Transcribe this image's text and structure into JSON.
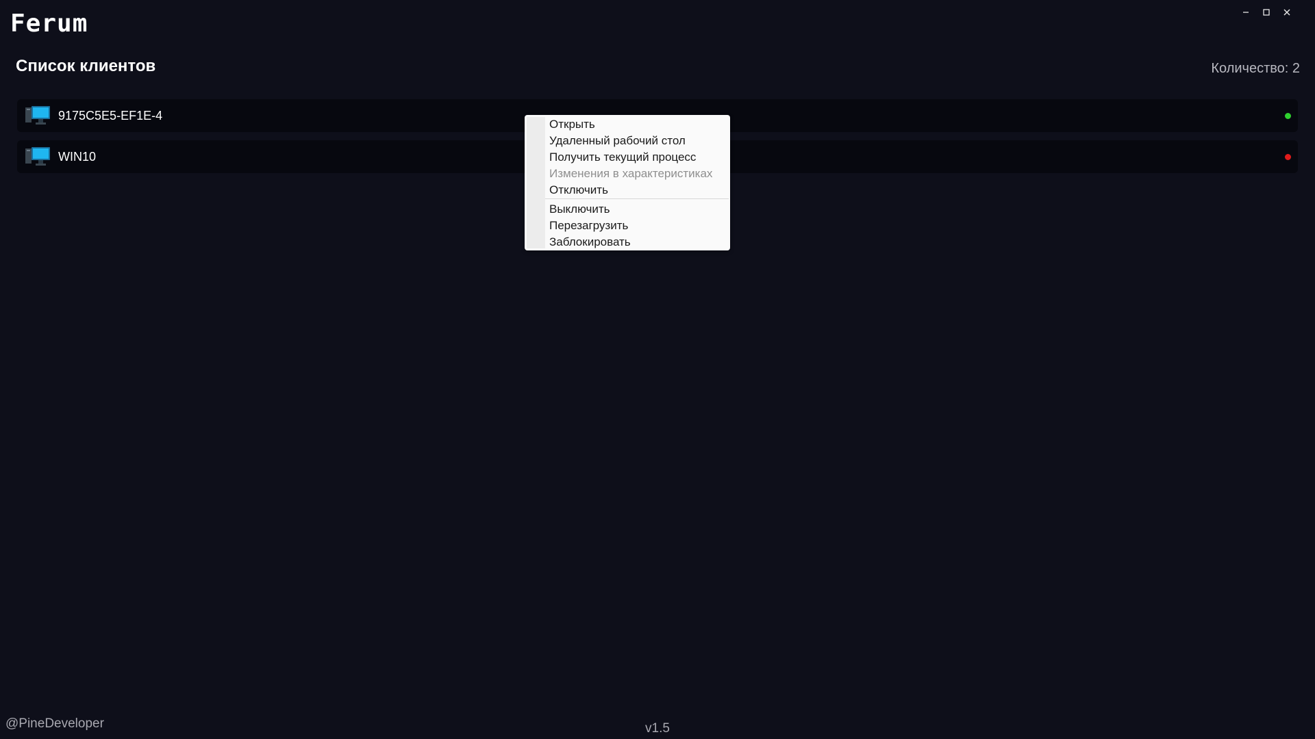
{
  "app": {
    "logo": "Ferum"
  },
  "window_controls": {
    "minimize_icon": "minimize-icon",
    "maximize_icon": "maximize-icon",
    "close_icon": "close-icon"
  },
  "header": {
    "title": "Список клиентов",
    "count_text": "Количество: 2"
  },
  "clients": [
    {
      "name": "9175C5E5-EF1E-4",
      "status": "online",
      "status_color": "#2fd12f",
      "icon": "desktop-computer-icon"
    },
    {
      "name": "WIN10",
      "status": "offline",
      "status_color": "#e01b1b",
      "icon": "desktop-computer-icon"
    }
  ],
  "context_menu": {
    "group1": [
      {
        "label": "Открыть",
        "enabled": true
      },
      {
        "label": "Удаленный рабочий стол",
        "enabled": true
      },
      {
        "label": "Получить текущий процесс",
        "enabled": true
      },
      {
        "label": "Изменения в характеристиках",
        "enabled": false
      },
      {
        "label": "Отключить",
        "enabled": true
      }
    ],
    "group2": [
      {
        "label": "Выключить",
        "enabled": true
      },
      {
        "label": "Перезагрузить",
        "enabled": true
      },
      {
        "label": "Заблокировать",
        "enabled": true
      }
    ]
  },
  "footer": {
    "author": "@PineDeveloper",
    "version": "v1.5"
  },
  "colors": {
    "background": "#0e0f1a",
    "row_background": "#07080f",
    "menu_background": "#fafafa",
    "accent_monitor": "#19a9e6"
  }
}
